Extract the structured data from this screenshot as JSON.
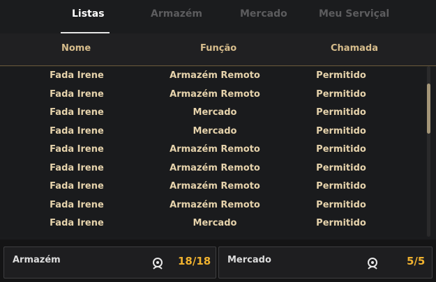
{
  "tabs": [
    {
      "label": "Listas",
      "active": true
    },
    {
      "label": "Armazém",
      "active": false
    },
    {
      "label": "Mercado",
      "active": false
    },
    {
      "label": "Meu Serviçal",
      "active": false
    }
  ],
  "columns": {
    "name": "Nome",
    "function": "Função",
    "call": "Chamada"
  },
  "rows": [
    {
      "name": "Fada Irene",
      "function": "Armazém Remoto",
      "call": "Permitido"
    },
    {
      "name": "Fada Irene",
      "function": "Armazém Remoto",
      "call": "Permitido"
    },
    {
      "name": "Fada Irene",
      "function": "Mercado",
      "call": "Permitido"
    },
    {
      "name": "Fada Irene",
      "function": "Mercado",
      "call": "Permitido"
    },
    {
      "name": "Fada Irene",
      "function": "Armazém Remoto",
      "call": "Permitido"
    },
    {
      "name": "Fada Irene",
      "function": "Armazém Remoto",
      "call": "Permitido"
    },
    {
      "name": "Fada Irene",
      "function": "Armazém Remoto",
      "call": "Permitido"
    },
    {
      "name": "Fada Irene",
      "function": "Armazém Remoto",
      "call": "Permitido"
    },
    {
      "name": "Fada Irene",
      "function": "Mercado",
      "call": "Permitido"
    }
  ],
  "summary": {
    "warehouse": {
      "label": "Armazém",
      "count": "18/18",
      "icon": "fairy-icon"
    },
    "market": {
      "label": "Mercado",
      "count": "5/5",
      "icon": "fairy-icon"
    }
  },
  "colors": {
    "accent": "#f0b22f",
    "header_text": "#d7bd8c",
    "row_text": "#e6d3ac"
  }
}
